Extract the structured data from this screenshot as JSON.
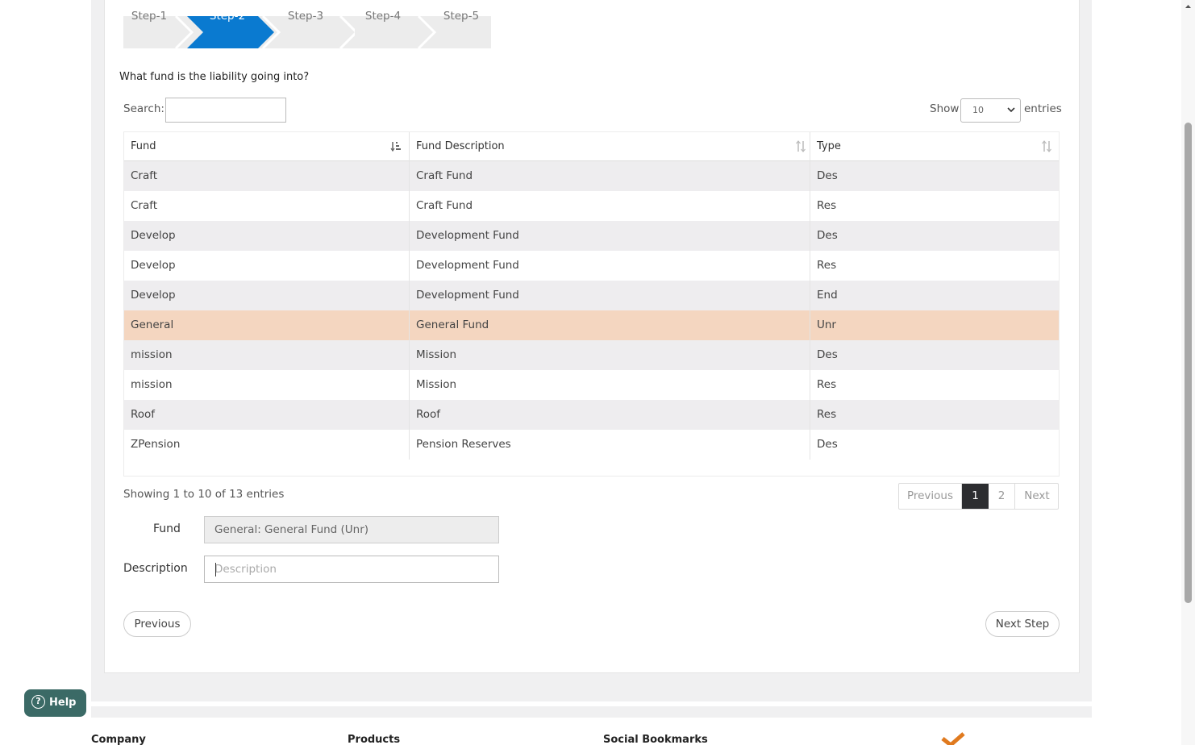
{
  "wizard": {
    "steps": [
      {
        "label": "Step-1",
        "active": false
      },
      {
        "label": "Step-2",
        "active": true
      },
      {
        "label": "Step-3",
        "active": false
      },
      {
        "label": "Step-4",
        "active": false
      },
      {
        "label": "Step-5",
        "active": false
      }
    ],
    "question": "What fund is the liability going into?"
  },
  "table_controls": {
    "search_label": "Search:",
    "search_value": "",
    "show_label": "Show",
    "page_size": "10",
    "entries_label": "entries"
  },
  "table": {
    "columns": [
      "Fund",
      "Fund Description",
      "Type"
    ],
    "rows": [
      {
        "fund": "Craft",
        "description": "Craft Fund",
        "type": "Des"
      },
      {
        "fund": "Craft",
        "description": "Craft Fund",
        "type": "Res"
      },
      {
        "fund": "Develop",
        "description": "Development Fund",
        "type": "Des"
      },
      {
        "fund": "Develop",
        "description": "Development Fund",
        "type": "Res"
      },
      {
        "fund": "Develop",
        "description": "Development Fund",
        "type": "End"
      },
      {
        "fund": "General",
        "description": "General Fund",
        "type": "Unr"
      },
      {
        "fund": "mission",
        "description": "Mission",
        "type": "Des"
      },
      {
        "fund": "mission",
        "description": "Mission",
        "type": "Res"
      },
      {
        "fund": "Roof",
        "description": "Roof",
        "type": "Res"
      },
      {
        "fund": "ZPension",
        "description": "Pension Reserves",
        "type": "Des"
      }
    ],
    "selected_row": 5,
    "info": "Showing 1 to 10 of 13 entries"
  },
  "pagination": {
    "previous": "Previous",
    "pages": [
      "1",
      "2"
    ],
    "current_page": "1",
    "next": "Next"
  },
  "form": {
    "fund_label": "Fund",
    "fund_value": "General: General Fund (Unr)",
    "description_label": "Description",
    "description_placeholder": "Description"
  },
  "buttons": {
    "previous": "Previous",
    "next_step": "Next Step"
  },
  "help": {
    "label": "Help"
  },
  "footer": {
    "columns": [
      "Company",
      "Products",
      "Social Bookmarks"
    ]
  },
  "colors": {
    "active_step": "#0a7ad0",
    "selected_row": "#f4d6c0",
    "help_button": "#3b6a66",
    "current_page": "#2c2d30"
  }
}
